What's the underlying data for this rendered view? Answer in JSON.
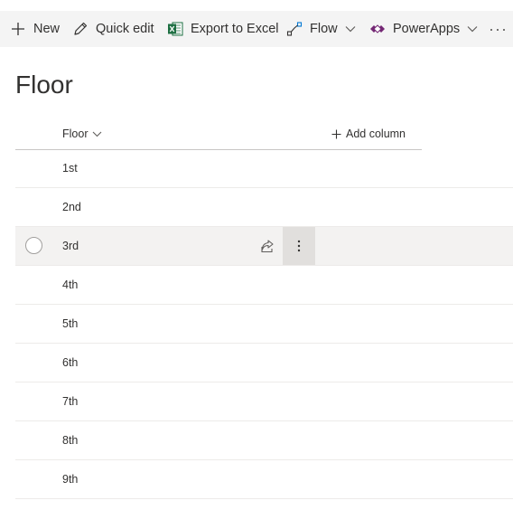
{
  "commandbar": {
    "new_label": "New",
    "quick_edit_label": "Quick edit",
    "export_label": "Export to Excel",
    "flow_label": "Flow",
    "powerapps_label": "PowerApps",
    "more_label": "···"
  },
  "page": {
    "title": "Floor"
  },
  "list": {
    "column_header": "Floor",
    "add_column_label": "Add column",
    "rows": [
      "1st",
      "2nd",
      "3rd",
      "4th",
      "5th",
      "6th",
      "7th",
      "8th",
      "9th"
    ]
  },
  "colors": {
    "accent": "#0078d4",
    "excel_green": "#1d6f42",
    "command_bar_bg": "#f4f4f4",
    "hover_row_bg": "#f3f2f1"
  },
  "icons": {
    "new": "plus-icon",
    "quick_edit": "pencil-icon",
    "export": "excel-icon",
    "flow": "flow-icon",
    "powerapps": "powerapps-icon",
    "share": "share-icon",
    "row_menu": "vertical-ellipsis-icon"
  }
}
